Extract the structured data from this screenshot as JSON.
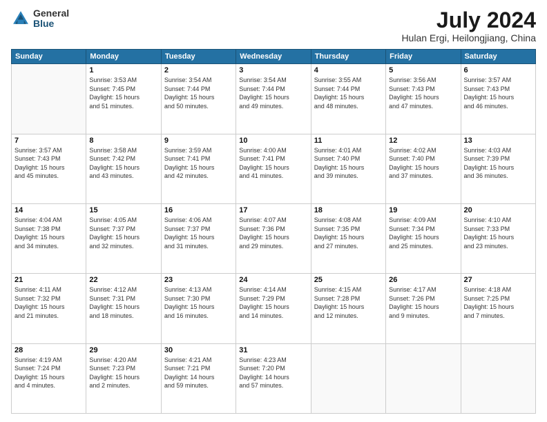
{
  "logo": {
    "general": "General",
    "blue": "Blue"
  },
  "title": "July 2024",
  "subtitle": "Hulan Ergi, Heilongjiang, China",
  "days_of_week": [
    "Sunday",
    "Monday",
    "Tuesday",
    "Wednesday",
    "Thursday",
    "Friday",
    "Saturday"
  ],
  "weeks": [
    [
      {
        "day": "",
        "info": ""
      },
      {
        "day": "1",
        "info": "Sunrise: 3:53 AM\nSunset: 7:45 PM\nDaylight: 15 hours\nand 51 minutes."
      },
      {
        "day": "2",
        "info": "Sunrise: 3:54 AM\nSunset: 7:44 PM\nDaylight: 15 hours\nand 50 minutes."
      },
      {
        "day": "3",
        "info": "Sunrise: 3:54 AM\nSunset: 7:44 PM\nDaylight: 15 hours\nand 49 minutes."
      },
      {
        "day": "4",
        "info": "Sunrise: 3:55 AM\nSunset: 7:44 PM\nDaylight: 15 hours\nand 48 minutes."
      },
      {
        "day": "5",
        "info": "Sunrise: 3:56 AM\nSunset: 7:43 PM\nDaylight: 15 hours\nand 47 minutes."
      },
      {
        "day": "6",
        "info": "Sunrise: 3:57 AM\nSunset: 7:43 PM\nDaylight: 15 hours\nand 46 minutes."
      }
    ],
    [
      {
        "day": "7",
        "info": "Sunrise: 3:57 AM\nSunset: 7:43 PM\nDaylight: 15 hours\nand 45 minutes."
      },
      {
        "day": "8",
        "info": "Sunrise: 3:58 AM\nSunset: 7:42 PM\nDaylight: 15 hours\nand 43 minutes."
      },
      {
        "day": "9",
        "info": "Sunrise: 3:59 AM\nSunset: 7:41 PM\nDaylight: 15 hours\nand 42 minutes."
      },
      {
        "day": "10",
        "info": "Sunrise: 4:00 AM\nSunset: 7:41 PM\nDaylight: 15 hours\nand 41 minutes."
      },
      {
        "day": "11",
        "info": "Sunrise: 4:01 AM\nSunset: 7:40 PM\nDaylight: 15 hours\nand 39 minutes."
      },
      {
        "day": "12",
        "info": "Sunrise: 4:02 AM\nSunset: 7:40 PM\nDaylight: 15 hours\nand 37 minutes."
      },
      {
        "day": "13",
        "info": "Sunrise: 4:03 AM\nSunset: 7:39 PM\nDaylight: 15 hours\nand 36 minutes."
      }
    ],
    [
      {
        "day": "14",
        "info": "Sunrise: 4:04 AM\nSunset: 7:38 PM\nDaylight: 15 hours\nand 34 minutes."
      },
      {
        "day": "15",
        "info": "Sunrise: 4:05 AM\nSunset: 7:37 PM\nDaylight: 15 hours\nand 32 minutes."
      },
      {
        "day": "16",
        "info": "Sunrise: 4:06 AM\nSunset: 7:37 PM\nDaylight: 15 hours\nand 31 minutes."
      },
      {
        "day": "17",
        "info": "Sunrise: 4:07 AM\nSunset: 7:36 PM\nDaylight: 15 hours\nand 29 minutes."
      },
      {
        "day": "18",
        "info": "Sunrise: 4:08 AM\nSunset: 7:35 PM\nDaylight: 15 hours\nand 27 minutes."
      },
      {
        "day": "19",
        "info": "Sunrise: 4:09 AM\nSunset: 7:34 PM\nDaylight: 15 hours\nand 25 minutes."
      },
      {
        "day": "20",
        "info": "Sunrise: 4:10 AM\nSunset: 7:33 PM\nDaylight: 15 hours\nand 23 minutes."
      }
    ],
    [
      {
        "day": "21",
        "info": "Sunrise: 4:11 AM\nSunset: 7:32 PM\nDaylight: 15 hours\nand 21 minutes."
      },
      {
        "day": "22",
        "info": "Sunrise: 4:12 AM\nSunset: 7:31 PM\nDaylight: 15 hours\nand 18 minutes."
      },
      {
        "day": "23",
        "info": "Sunrise: 4:13 AM\nSunset: 7:30 PM\nDaylight: 15 hours\nand 16 minutes."
      },
      {
        "day": "24",
        "info": "Sunrise: 4:14 AM\nSunset: 7:29 PM\nDaylight: 15 hours\nand 14 minutes."
      },
      {
        "day": "25",
        "info": "Sunrise: 4:15 AM\nSunset: 7:28 PM\nDaylight: 15 hours\nand 12 minutes."
      },
      {
        "day": "26",
        "info": "Sunrise: 4:17 AM\nSunset: 7:26 PM\nDaylight: 15 hours\nand 9 minutes."
      },
      {
        "day": "27",
        "info": "Sunrise: 4:18 AM\nSunset: 7:25 PM\nDaylight: 15 hours\nand 7 minutes."
      }
    ],
    [
      {
        "day": "28",
        "info": "Sunrise: 4:19 AM\nSunset: 7:24 PM\nDaylight: 15 hours\nand 4 minutes."
      },
      {
        "day": "29",
        "info": "Sunrise: 4:20 AM\nSunset: 7:23 PM\nDaylight: 15 hours\nand 2 minutes."
      },
      {
        "day": "30",
        "info": "Sunrise: 4:21 AM\nSunset: 7:21 PM\nDaylight: 14 hours\nand 59 minutes."
      },
      {
        "day": "31",
        "info": "Sunrise: 4:23 AM\nSunset: 7:20 PM\nDaylight: 14 hours\nand 57 minutes."
      },
      {
        "day": "",
        "info": ""
      },
      {
        "day": "",
        "info": ""
      },
      {
        "day": "",
        "info": ""
      }
    ]
  ]
}
